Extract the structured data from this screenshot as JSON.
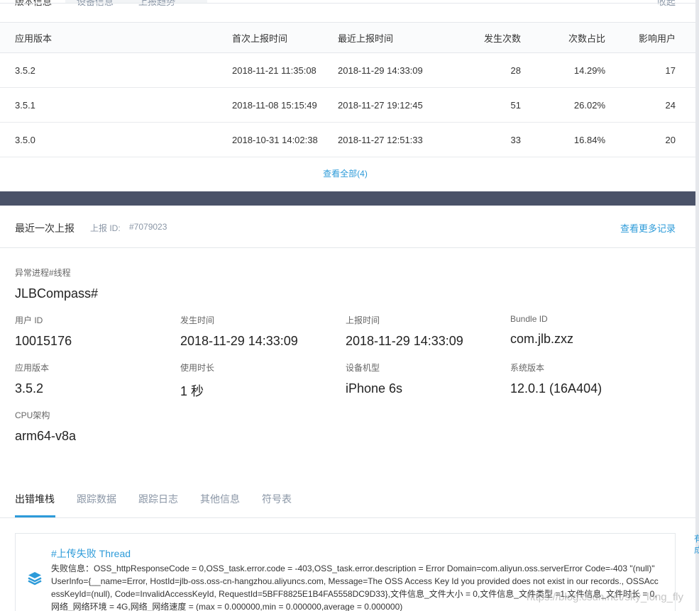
{
  "top_tabs": {
    "version_info": "版本信息",
    "device_info": "设备信息",
    "report_trend": "上报趋势",
    "right_text": "收起"
  },
  "versions_table": {
    "headers": [
      "应用版本",
      "首次上报时间",
      "最近上报时间",
      "发生次数",
      "次数占比",
      "影响用户"
    ],
    "rows": [
      [
        "3.5.2",
        "2018-11-21 11:35:08",
        "2018-11-29 14:33:09",
        "28",
        "14.29%",
        "17"
      ],
      [
        "3.5.1",
        "2018-11-08 15:15:49",
        "2018-11-27 19:12:45",
        "51",
        "26.02%",
        "24"
      ],
      [
        "3.5.0",
        "2018-10-31 14:02:38",
        "2018-11-27 12:51:33",
        "33",
        "16.84%",
        "20"
      ]
    ],
    "view_all": "查看全部(4)"
  },
  "report": {
    "title": "最近一次上报",
    "id_label": "上报 ID:",
    "id_value": "#7079023",
    "more_link": "查看更多记录",
    "fields": {
      "process": {
        "label": "异常进程#线程",
        "value": "JLBCompass#"
      },
      "user_id": {
        "label": "用户 ID",
        "value": "10015176"
      },
      "occur_time": {
        "label": "发生时间",
        "value": "2018-11-29 14:33:09"
      },
      "report_time": {
        "label": "上报时间",
        "value": "2018-11-29 14:33:09"
      },
      "bundle_id": {
        "label": "Bundle ID",
        "value": "com.jlb.zxz"
      },
      "app_version": {
        "label": "应用版本",
        "value": "3.5.2"
      },
      "usage_duration": {
        "label": "使用时长",
        "value": "1 秒"
      },
      "device_model": {
        "label": "设备机型",
        "value": "iPhone 6s"
      },
      "os_version": {
        "label": "系统版本",
        "value": "12.0.1 (16A404)"
      },
      "cpu_arch": {
        "label": "CPU架构",
        "value": "arm64-v8a"
      }
    }
  },
  "sub_tabs": [
    "出错堆栈",
    "跟踪数据",
    "跟踪日志",
    "其他信息",
    "符号表"
  ],
  "stack": {
    "title": "#上传失败 Thread",
    "text": "失败信息：OSS_httpResponseCode = 0,OSS_task.error.code = -403,OSS_task.error.description = Error Domain=com.aliyun.oss.serverError Code=-403 \"(null)\" UserInfo={__name=Error, HostId=jlb-oss.oss-cn-hangzhou.aliyuncs.com, Message=The OSS Access Key Id you provided does not exist in our records., OSSAccessKeyId=(null), Code=InvalidAccessKeyId, RequestId=5BFF8825E1B4FA5558DC9D33},文件信息_文件大小 = 0,文件信息_文件类型 =1,文件信息_文件时长 = 0,网络_网络环境 = 4G,网络_网络速度 = (max = 0.000000,min = 0.000000,average = 0.000000)"
  },
  "side_bits": "有 成",
  "watermark": "https://blog.csdn.net/sky_long_fly",
  "colors": {
    "accent": "#2d9bd9",
    "band": "#4a5268",
    "muted": "#8a96a6"
  }
}
